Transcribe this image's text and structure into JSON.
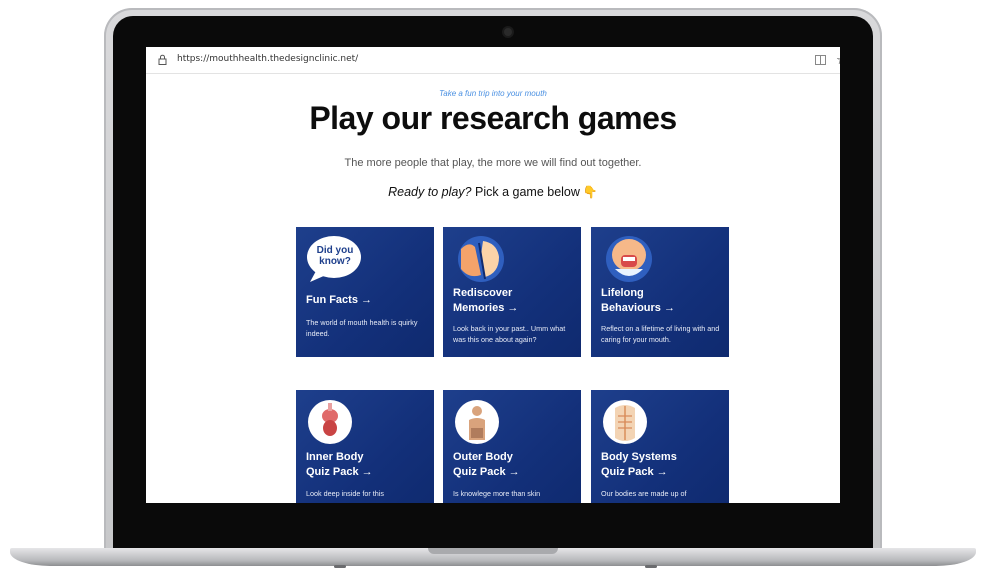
{
  "browser": {
    "url": "https://mouthhealth.thedesignclinic.net/"
  },
  "page": {
    "tagline": "Take a fun trip into your mouth",
    "title": "Play our research games",
    "subtitle": "The more people that play, the more we will find out together.",
    "prompt_italic": "Ready to play?",
    "prompt_rest": " Pick a game below"
  },
  "games": [
    {
      "title_line1": "Fun Facts →",
      "title_line2": "",
      "description": "The world of mouth health is quirky indeed.",
      "icon_text": "Did you know?",
      "icon": "speech-bubble-icon"
    },
    {
      "title_line1": "Rediscover",
      "title_line2": "Memories →",
      "description": "Look back in your past.. Umm what was this one about again?",
      "icon": "memory-faces-icon"
    },
    {
      "title_line1": "Lifelong",
      "title_line2": "Behaviours →",
      "description": "Reflect on a lifetime of living with and caring for your mouth.",
      "icon": "face-toothbrush-icon"
    },
    {
      "title_line1": "Inner Body",
      "title_line2": "Quiz Pack →",
      "description": "Look deep inside for this",
      "icon": "organs-icon"
    },
    {
      "title_line1": "Outer Body",
      "title_line2": "Quiz Pack →",
      "description": "Is knowlege more than skin",
      "icon": "body-figure-icon"
    },
    {
      "title_line1": "Body Systems",
      "title_line2": "Quiz Pack →",
      "description": "Our bodies are made up of",
      "icon": "skeleton-icon"
    }
  ],
  "colors": {
    "card_bg": "#13307a",
    "tagline": "#4a90e2",
    "title": "#0d0d0d"
  }
}
